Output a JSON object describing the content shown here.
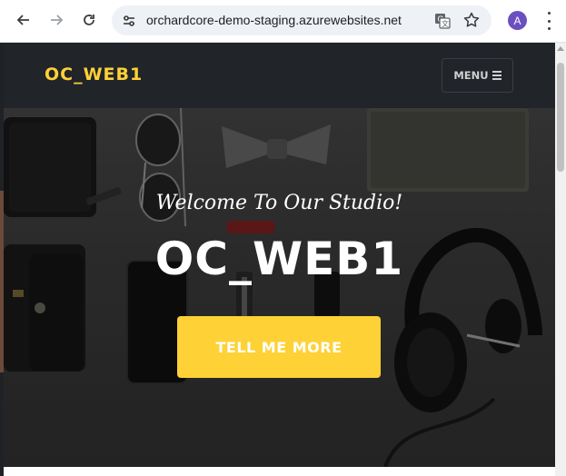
{
  "browser": {
    "url": "orchardcore-demo-staging.azurewebsites.net",
    "avatar_initial": "A",
    "icons": [
      "back-icon",
      "forward-icon",
      "reload-icon",
      "site-settings-icon",
      "translate-icon",
      "star-icon",
      "more-menu-icon"
    ]
  },
  "site": {
    "brand": "OC_WEB1",
    "menu_label": "MENU",
    "brand_color": "#fed136"
  },
  "hero": {
    "subheading": "Welcome To Our Studio!",
    "heading": "OC_WEB1",
    "cta_label": "TELL ME MORE",
    "cta_color": "#fed136"
  }
}
